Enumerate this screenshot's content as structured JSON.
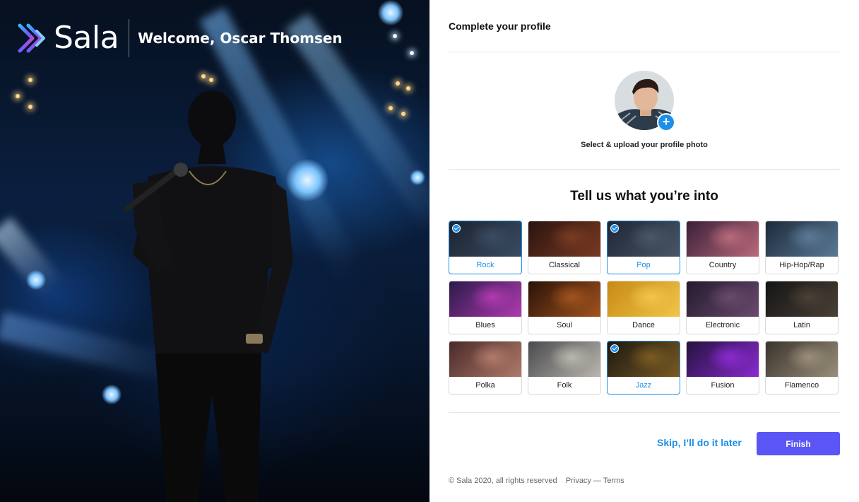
{
  "brand": {
    "name": "Sala",
    "welcome": "Welcome, Oscar Thomsen"
  },
  "panel": {
    "title": "Complete your profile"
  },
  "profile": {
    "upload_caption": "Select & upload your profile photo",
    "add_icon": "plus-icon"
  },
  "interests": {
    "title": "Tell us what you’re into",
    "genres": [
      {
        "label": "Rock",
        "selected": true,
        "colors": [
          "#1b2230",
          "#3a4c62"
        ]
      },
      {
        "label": "Classical",
        "selected": false,
        "colors": [
          "#2a1410",
          "#7a3a22"
        ]
      },
      {
        "label": "Pop",
        "selected": true,
        "colors": [
          "#1d2637",
          "#4a5666"
        ]
      },
      {
        "label": "Country",
        "selected": false,
        "colors": [
          "#3a1f3a",
          "#b96a7a"
        ]
      },
      {
        "label": "Hip-Hop/Rap",
        "selected": false,
        "colors": [
          "#1c2a3a",
          "#5b7a96"
        ]
      },
      {
        "label": "Blues",
        "selected": false,
        "colors": [
          "#2a1a4a",
          "#b03ab0"
        ]
      },
      {
        "label": "Soul",
        "selected": false,
        "colors": [
          "#2a1208",
          "#a2531e"
        ]
      },
      {
        "label": "Dance",
        "selected": false,
        "colors": [
          "#c78a14",
          "#f2c54a"
        ]
      },
      {
        "label": "Electronic",
        "selected": false,
        "colors": [
          "#241a2e",
          "#6a4a6e"
        ]
      },
      {
        "label": "Latin",
        "selected": false,
        "colors": [
          "#151414",
          "#4a4036"
        ]
      },
      {
        "label": "Polka",
        "selected": false,
        "colors": [
          "#4a2a2a",
          "#b07a6a"
        ]
      },
      {
        "label": "Folk",
        "selected": false,
        "colors": [
          "#4a4a4e",
          "#b9b6ae"
        ]
      },
      {
        "label": "Jazz",
        "selected": true,
        "colors": [
          "#1a1812",
          "#7a5a22"
        ]
      },
      {
        "label": "Fusion",
        "selected": false,
        "colors": [
          "#24123e",
          "#8a2ad0"
        ]
      },
      {
        "label": "Flamenco",
        "selected": false,
        "colors": [
          "#3a342c",
          "#9a8e7a"
        ]
      }
    ]
  },
  "actions": {
    "skip_label": "Skip, I’ll do it later",
    "finish_label": "Finish"
  },
  "footer": {
    "copyright": "© Sala 2020, all rights reserved",
    "privacy": "Privacy",
    "separator": "—",
    "terms": "Terms"
  },
  "colors": {
    "accent": "#1d8fe8",
    "primary_button": "#5b55f6",
    "selected_border": "#1d8fe8"
  }
}
